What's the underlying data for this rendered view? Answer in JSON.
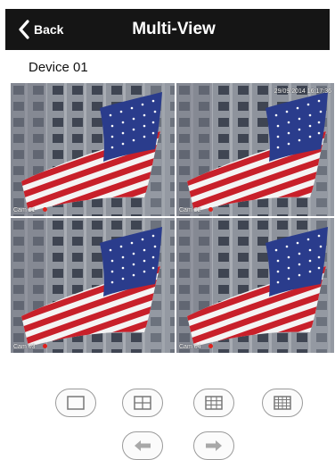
{
  "navbar": {
    "back_label": "Back",
    "title": "Multi-View",
    "back_icon": "chevron-left-icon"
  },
  "device": {
    "name": "Device 01"
  },
  "cameras": [
    {
      "label": "Cam 01",
      "timestamp": ""
    },
    {
      "label": "Cam 02",
      "timestamp": "29/09/2014 16:17:36"
    },
    {
      "label": "Cam 03",
      "timestamp": ""
    },
    {
      "label": "Cam 04",
      "timestamp": ""
    }
  ],
  "layout_buttons": [
    {
      "icon": "single-view-icon"
    },
    {
      "icon": "quad-view-icon"
    },
    {
      "icon": "nine-view-icon"
    },
    {
      "icon": "sixteen-view-icon"
    }
  ],
  "nav_buttons": [
    {
      "icon": "arrow-left-icon"
    },
    {
      "icon": "arrow-right-icon"
    }
  ],
  "colors": {
    "navbar": "#151515",
    "flag_red": "#c8202a",
    "flag_blue": "#2a3c8c",
    "record": "#e0201c"
  }
}
